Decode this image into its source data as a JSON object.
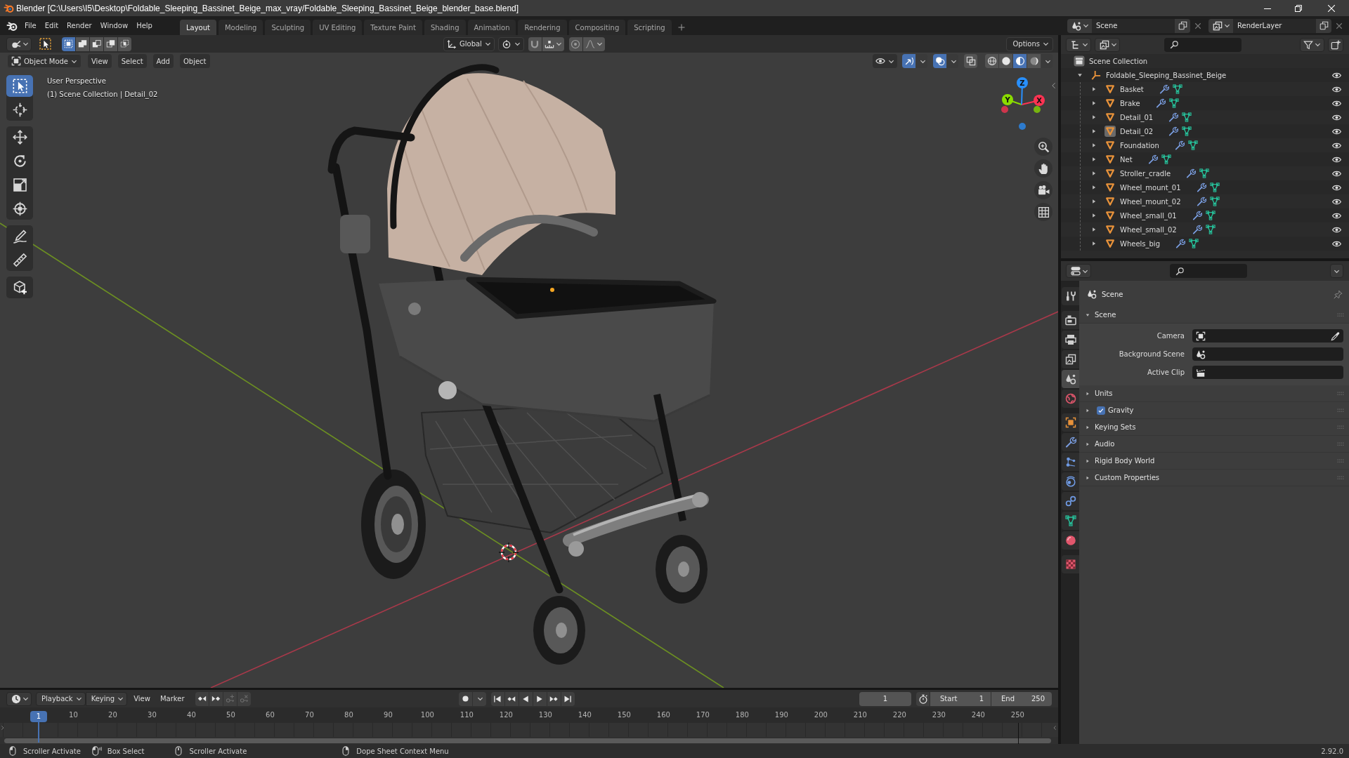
{
  "window": {
    "title": "Blender [C:\\Users\\I5\\Desktop\\Foldable_Sleeping_Bassinet_Beige_max_vray/Foldable_Sleeping_Bassinet_Beige_blender_base.blend]"
  },
  "top_bar": {
    "menus": [
      "File",
      "Edit",
      "Render",
      "Window",
      "Help"
    ],
    "workspaces": [
      {
        "label": "Layout",
        "selected": true
      },
      {
        "label": "Modeling",
        "selected": false
      },
      {
        "label": "Sculpting",
        "selected": false
      },
      {
        "label": "UV Editing",
        "selected": false
      },
      {
        "label": "Texture Paint",
        "selected": false
      },
      {
        "label": "Shading",
        "selected": false
      },
      {
        "label": "Animation",
        "selected": false
      },
      {
        "label": "Rendering",
        "selected": false
      },
      {
        "label": "Compositing",
        "selected": false
      },
      {
        "label": "Scripting",
        "selected": false
      }
    ],
    "scene": "Scene",
    "view_layer": "RenderLayer"
  },
  "tool_header": {
    "select_modes": [
      {
        "kind": "set",
        "selected": true
      },
      {
        "kind": "extend",
        "selected": false
      },
      {
        "kind": "subtract",
        "selected": false
      },
      {
        "kind": "difference",
        "selected": false
      },
      {
        "kind": "intersect",
        "selected": false
      }
    ],
    "orientation": "Global",
    "options": "Options"
  },
  "viewport_header": {
    "mode": "Object Mode",
    "menus": [
      "View",
      "Select",
      "Add",
      "Object"
    ],
    "toggles": [
      {
        "kind": "gizmos",
        "on": true
      },
      {
        "kind": "overlays",
        "on": true
      },
      {
        "kind": "xray",
        "on": false
      }
    ],
    "shading": [
      {
        "kind": "wireframe",
        "selected": false
      },
      {
        "kind": "solid",
        "selected": false
      },
      {
        "kind": "material",
        "selected": true
      },
      {
        "kind": "rendered",
        "selected": false
      }
    ]
  },
  "viewport": {
    "info": [
      "User Perspective",
      "(1) Scene Collection | Detail_02"
    ],
    "tool_groups": [
      [
        {
          "kind": "select",
          "selected": true
        },
        {
          "kind": "cursor",
          "selected": false
        }
      ],
      [
        {
          "kind": "move",
          "selected": false
        },
        {
          "kind": "rotate",
          "selected": false
        },
        {
          "kind": "scale",
          "selected": false
        },
        {
          "kind": "transform",
          "selected": false
        }
      ],
      [
        {
          "kind": "annotate",
          "selected": false
        },
        {
          "kind": "measure",
          "selected": false
        }
      ],
      [
        {
          "kind": "add_cube",
          "selected": false
        }
      ]
    ],
    "gizmo_axes": [
      {
        "label": "X",
        "color": "#ff3352"
      },
      {
        "label": "Y",
        "color": "#8bdc00"
      },
      {
        "label": "Z",
        "color": "#2890ff"
      }
    ]
  },
  "outliner": {
    "tree": [
      {
        "label": "Scene Collection",
        "kind": "collection",
        "children": [
          {
            "label": "Foldable_Sleeping_Bassinet_Beige",
            "kind": "empty",
            "expanded": true,
            "active": false,
            "visible": true,
            "children": [
              {
                "label": "Basket",
                "kind": "mesh",
                "expanded": false,
                "active": false,
                "visible": true
              },
              {
                "label": "Brake",
                "kind": "mesh",
                "expanded": false,
                "active": false,
                "visible": true
              },
              {
                "label": "Detail_01",
                "kind": "mesh",
                "expanded": false,
                "active": false,
                "visible": true
              },
              {
                "label": "Detail_02",
                "kind": "mesh",
                "expanded": false,
                "active": true,
                "visible": true
              },
              {
                "label": "Foundation",
                "kind": "mesh",
                "expanded": false,
                "active": false,
                "visible": true
              },
              {
                "label": "Net",
                "kind": "mesh",
                "expanded": false,
                "active": false,
                "visible": true
              },
              {
                "label": "Stroller_cradle",
                "kind": "mesh",
                "expanded": false,
                "active": false,
                "visible": true
              },
              {
                "label": "Wheel_mount_01",
                "kind": "mesh",
                "expanded": false,
                "active": false,
                "visible": true
              },
              {
                "label": "Wheel_mount_02",
                "kind": "mesh",
                "expanded": false,
                "active": false,
                "visible": true
              },
              {
                "label": "Wheel_small_01",
                "kind": "mesh",
                "expanded": false,
                "active": false,
                "visible": true
              },
              {
                "label": "Wheel_small_02",
                "kind": "mesh",
                "expanded": false,
                "active": false,
                "visible": true
              },
              {
                "label": "Wheels_big",
                "kind": "mesh",
                "expanded": false,
                "active": false,
                "visible": true
              }
            ]
          }
        ]
      }
    ]
  },
  "properties": {
    "tab_groups": [
      [
        {
          "kind": "tool",
          "selected": false
        }
      ],
      [
        {
          "kind": "render",
          "selected": false
        },
        {
          "kind": "output",
          "selected": false
        },
        {
          "kind": "view_layer",
          "selected": false
        },
        {
          "kind": "scene",
          "selected": true
        },
        {
          "kind": "world",
          "selected": false
        }
      ],
      [
        {
          "kind": "object",
          "selected": false
        },
        {
          "kind": "modifiers",
          "selected": false
        },
        {
          "kind": "particles",
          "selected": false
        },
        {
          "kind": "physics",
          "selected": false
        },
        {
          "kind": "constraints",
          "selected": false
        },
        {
          "kind": "data",
          "selected": false
        },
        {
          "kind": "material",
          "selected": false
        }
      ],
      [
        {
          "kind": "texture",
          "selected": false
        }
      ]
    ],
    "context": "Scene",
    "panels": [
      {
        "title": "Scene",
        "expanded": true,
        "fields": [
          {
            "label": "Camera",
            "kind": "camera"
          },
          {
            "label": "Background Scene",
            "kind": "scene"
          },
          {
            "label": "Active Clip",
            "kind": "clip"
          }
        ]
      },
      {
        "title": "Units",
        "expanded": false
      },
      {
        "title": "Gravity",
        "expanded": false,
        "toggle": {
          "checked": true
        }
      },
      {
        "title": "Keying Sets",
        "expanded": false
      },
      {
        "title": "Audio",
        "expanded": false
      },
      {
        "title": "Rigid Body World",
        "expanded": false
      },
      {
        "title": "Custom Properties",
        "expanded": false
      }
    ]
  },
  "timeline": {
    "menus": [
      {
        "label": "Playback",
        "kind": "dropdown"
      },
      {
        "label": "Keying",
        "kind": "dropdown"
      },
      {
        "label": "View",
        "kind": "menu"
      },
      {
        "label": "Marker",
        "kind": "menu"
      }
    ],
    "key_tools": [
      {
        "kind": "prev",
        "disabled": false
      },
      {
        "kind": "next",
        "disabled": false
      },
      {
        "kind": "insert",
        "disabled": true
      },
      {
        "kind": "delete",
        "disabled": true
      }
    ],
    "current_frame": "1",
    "start": {
      "label": "Start",
      "value": "1"
    },
    "end": {
      "label": "End",
      "value": "250"
    },
    "ruler": {
      "current": "1",
      "ticks": [
        "10",
        "20",
        "30",
        "40",
        "50",
        "60",
        "70",
        "80",
        "90",
        "100",
        "110",
        "120",
        "130",
        "140",
        "150",
        "160",
        "170",
        "180",
        "190",
        "200",
        "210",
        "220",
        "230",
        "240",
        "250"
      ]
    }
  },
  "status_bar": {
    "hints": [
      {
        "kind": "left",
        "label": "Scroller Activate"
      },
      {
        "kind": "drag",
        "label": "Box Select"
      },
      {
        "kind": "middle",
        "label": "Scroller Activate"
      },
      {
        "kind": "right",
        "label": "Dope Sheet Context Menu"
      }
    ],
    "version": "2.92.0"
  }
}
